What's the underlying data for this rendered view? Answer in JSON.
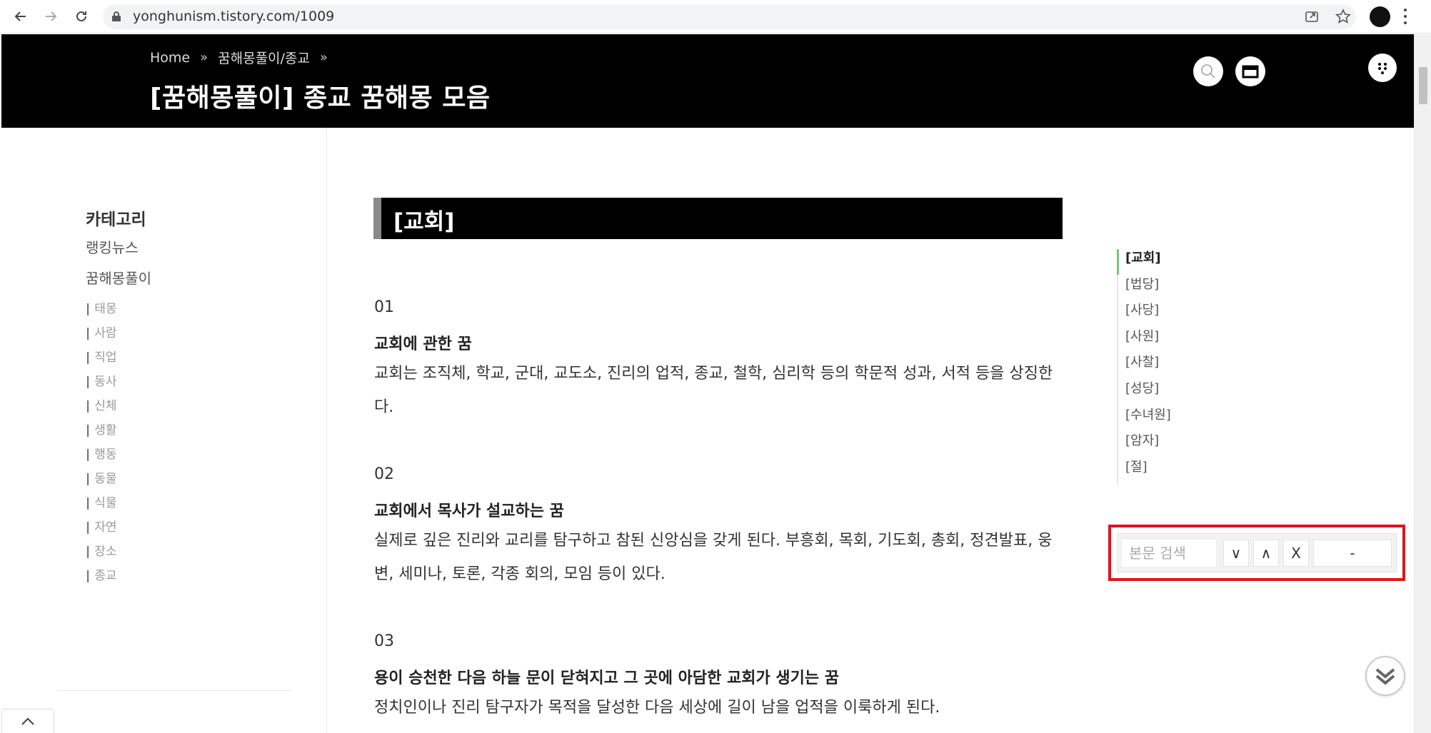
{
  "browser": {
    "url": "yonghunism.tistory.com/1009"
  },
  "header": {
    "breadcrumb": [
      "Home",
      "꿈해몽풀이/종교"
    ],
    "breadcrumb_sep": "»",
    "title": "[꿈해몽풀이] 종교 꿈해몽 모음"
  },
  "sidebar": {
    "category_title": "카테고리",
    "main_items": [
      "랭킹뉴스",
      "꿈해몽풀이"
    ],
    "sub_items": [
      "태몽",
      "사람",
      "직업",
      "동사",
      "신체",
      "생활",
      "행동",
      "동물",
      "식물",
      "자연",
      "장소",
      "종교"
    ]
  },
  "article": {
    "section_title": "[교회]",
    "entries": [
      {
        "num": "01",
        "subtitle": "교회에 관한 꿈",
        "text": "교회는 조직체, 학교, 군대, 교도소, 진리의 업적, 종교, 철학, 심리학 등의 학문적 성과, 서적 등을 상징한다."
      },
      {
        "num": "02",
        "subtitle": "교회에서 목사가 설교하는 꿈",
        "text": "실제로 깊은 진리와 교리를 탐구하고 참된 신앙심을 갖게 된다. 부흥회, 목회, 기도회, 총회, 정견발표, 웅변, 세미나, 토론, 각종 회의, 모임 등이 있다."
      },
      {
        "num": "03",
        "subtitle": "용이 승천한 다음 하늘 문이 닫혀지고 그 곳에 아담한 교회가 생기는 꿈",
        "text": "정치인이나 진리 탐구자가 목적을 달성한 다음 세상에 길이 남을 업적을 이룩하게 된다."
      }
    ]
  },
  "toc": {
    "items": [
      "[교회]",
      "[법당]",
      "[사당]",
      "[사원]",
      "[사찰]",
      "[성당]",
      "[수녀원]",
      "[암자]",
      "[절]"
    ],
    "active_index": 0
  },
  "find": {
    "placeholder": "본문 검색",
    "down_label": "∨",
    "up_label": "∧",
    "close_label": "X",
    "minimize_label": "-"
  },
  "colors": {
    "header_bg": "#000000",
    "find_border": "#e0141e",
    "toc_active": "#7cc576"
  }
}
